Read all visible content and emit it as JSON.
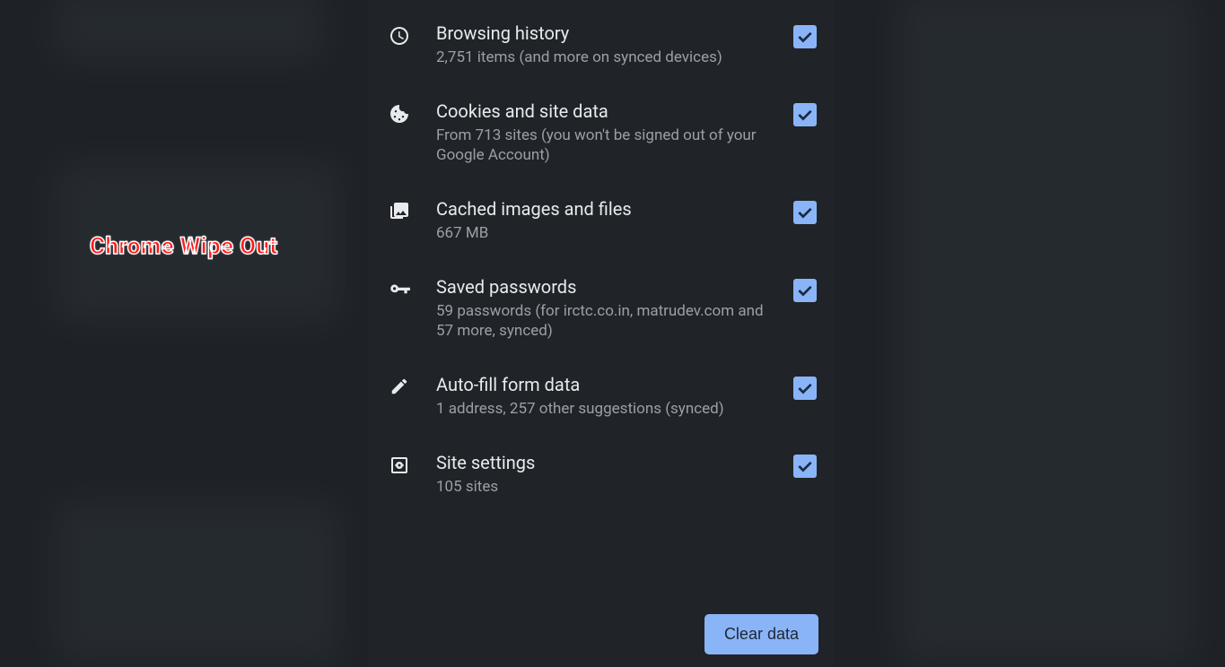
{
  "overlay": {
    "label": "Chrome Wipe Out"
  },
  "items": [
    {
      "icon": "clock-icon",
      "title": "Browsing history",
      "sub": "2,751 items (and more on synced devices)",
      "checked": true
    },
    {
      "icon": "cookie-icon",
      "title": "Cookies and site data",
      "sub": "From 713 sites (you won't be signed out of your Google Account)",
      "checked": true
    },
    {
      "icon": "image-icon",
      "title": "Cached images and files",
      "sub": "667 MB",
      "checked": true
    },
    {
      "icon": "key-icon",
      "title": "Saved passwords",
      "sub": "59 passwords (for irctc.co.in, matrudev.com and 57 more, synced)",
      "checked": true
    },
    {
      "icon": "pencil-icon",
      "title": "Auto-fill form data",
      "sub": "1 address, 257 other suggestions (synced)",
      "checked": true
    },
    {
      "icon": "site-settings-icon",
      "title": "Site settings",
      "sub": "105 sites",
      "checked": true
    }
  ],
  "actions": {
    "clear_label": "Clear data"
  }
}
